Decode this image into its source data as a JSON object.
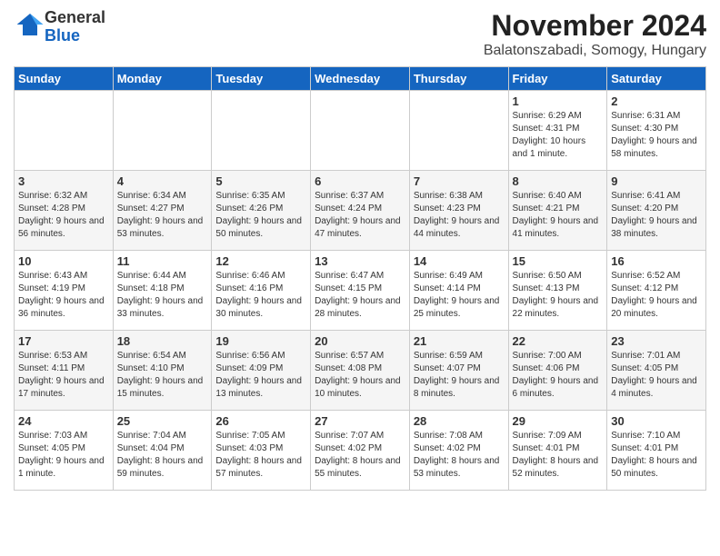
{
  "header": {
    "logo_general": "General",
    "logo_blue": "Blue",
    "month_title": "November 2024",
    "location": "Balatonszabadi, Somogy, Hungary"
  },
  "weekdays": [
    "Sunday",
    "Monday",
    "Tuesday",
    "Wednesday",
    "Thursday",
    "Friday",
    "Saturday"
  ],
  "weeks": [
    [
      {
        "day": "",
        "info": ""
      },
      {
        "day": "",
        "info": ""
      },
      {
        "day": "",
        "info": ""
      },
      {
        "day": "",
        "info": ""
      },
      {
        "day": "",
        "info": ""
      },
      {
        "day": "1",
        "info": "Sunrise: 6:29 AM\nSunset: 4:31 PM\nDaylight: 10 hours and 1 minute."
      },
      {
        "day": "2",
        "info": "Sunrise: 6:31 AM\nSunset: 4:30 PM\nDaylight: 9 hours and 58 minutes."
      }
    ],
    [
      {
        "day": "3",
        "info": "Sunrise: 6:32 AM\nSunset: 4:28 PM\nDaylight: 9 hours and 56 minutes."
      },
      {
        "day": "4",
        "info": "Sunrise: 6:34 AM\nSunset: 4:27 PM\nDaylight: 9 hours and 53 minutes."
      },
      {
        "day": "5",
        "info": "Sunrise: 6:35 AM\nSunset: 4:26 PM\nDaylight: 9 hours and 50 minutes."
      },
      {
        "day": "6",
        "info": "Sunrise: 6:37 AM\nSunset: 4:24 PM\nDaylight: 9 hours and 47 minutes."
      },
      {
        "day": "7",
        "info": "Sunrise: 6:38 AM\nSunset: 4:23 PM\nDaylight: 9 hours and 44 minutes."
      },
      {
        "day": "8",
        "info": "Sunrise: 6:40 AM\nSunset: 4:21 PM\nDaylight: 9 hours and 41 minutes."
      },
      {
        "day": "9",
        "info": "Sunrise: 6:41 AM\nSunset: 4:20 PM\nDaylight: 9 hours and 38 minutes."
      }
    ],
    [
      {
        "day": "10",
        "info": "Sunrise: 6:43 AM\nSunset: 4:19 PM\nDaylight: 9 hours and 36 minutes."
      },
      {
        "day": "11",
        "info": "Sunrise: 6:44 AM\nSunset: 4:18 PM\nDaylight: 9 hours and 33 minutes."
      },
      {
        "day": "12",
        "info": "Sunrise: 6:46 AM\nSunset: 4:16 PM\nDaylight: 9 hours and 30 minutes."
      },
      {
        "day": "13",
        "info": "Sunrise: 6:47 AM\nSunset: 4:15 PM\nDaylight: 9 hours and 28 minutes."
      },
      {
        "day": "14",
        "info": "Sunrise: 6:49 AM\nSunset: 4:14 PM\nDaylight: 9 hours and 25 minutes."
      },
      {
        "day": "15",
        "info": "Sunrise: 6:50 AM\nSunset: 4:13 PM\nDaylight: 9 hours and 22 minutes."
      },
      {
        "day": "16",
        "info": "Sunrise: 6:52 AM\nSunset: 4:12 PM\nDaylight: 9 hours and 20 minutes."
      }
    ],
    [
      {
        "day": "17",
        "info": "Sunrise: 6:53 AM\nSunset: 4:11 PM\nDaylight: 9 hours and 17 minutes."
      },
      {
        "day": "18",
        "info": "Sunrise: 6:54 AM\nSunset: 4:10 PM\nDaylight: 9 hours and 15 minutes."
      },
      {
        "day": "19",
        "info": "Sunrise: 6:56 AM\nSunset: 4:09 PM\nDaylight: 9 hours and 13 minutes."
      },
      {
        "day": "20",
        "info": "Sunrise: 6:57 AM\nSunset: 4:08 PM\nDaylight: 9 hours and 10 minutes."
      },
      {
        "day": "21",
        "info": "Sunrise: 6:59 AM\nSunset: 4:07 PM\nDaylight: 9 hours and 8 minutes."
      },
      {
        "day": "22",
        "info": "Sunrise: 7:00 AM\nSunset: 4:06 PM\nDaylight: 9 hours and 6 minutes."
      },
      {
        "day": "23",
        "info": "Sunrise: 7:01 AM\nSunset: 4:05 PM\nDaylight: 9 hours and 4 minutes."
      }
    ],
    [
      {
        "day": "24",
        "info": "Sunrise: 7:03 AM\nSunset: 4:05 PM\nDaylight: 9 hours and 1 minute."
      },
      {
        "day": "25",
        "info": "Sunrise: 7:04 AM\nSunset: 4:04 PM\nDaylight: 8 hours and 59 minutes."
      },
      {
        "day": "26",
        "info": "Sunrise: 7:05 AM\nSunset: 4:03 PM\nDaylight: 8 hours and 57 minutes."
      },
      {
        "day": "27",
        "info": "Sunrise: 7:07 AM\nSunset: 4:02 PM\nDaylight: 8 hours and 55 minutes."
      },
      {
        "day": "28",
        "info": "Sunrise: 7:08 AM\nSunset: 4:02 PM\nDaylight: 8 hours and 53 minutes."
      },
      {
        "day": "29",
        "info": "Sunrise: 7:09 AM\nSunset: 4:01 PM\nDaylight: 8 hours and 52 minutes."
      },
      {
        "day": "30",
        "info": "Sunrise: 7:10 AM\nSunset: 4:01 PM\nDaylight: 8 hours and 50 minutes."
      }
    ]
  ]
}
